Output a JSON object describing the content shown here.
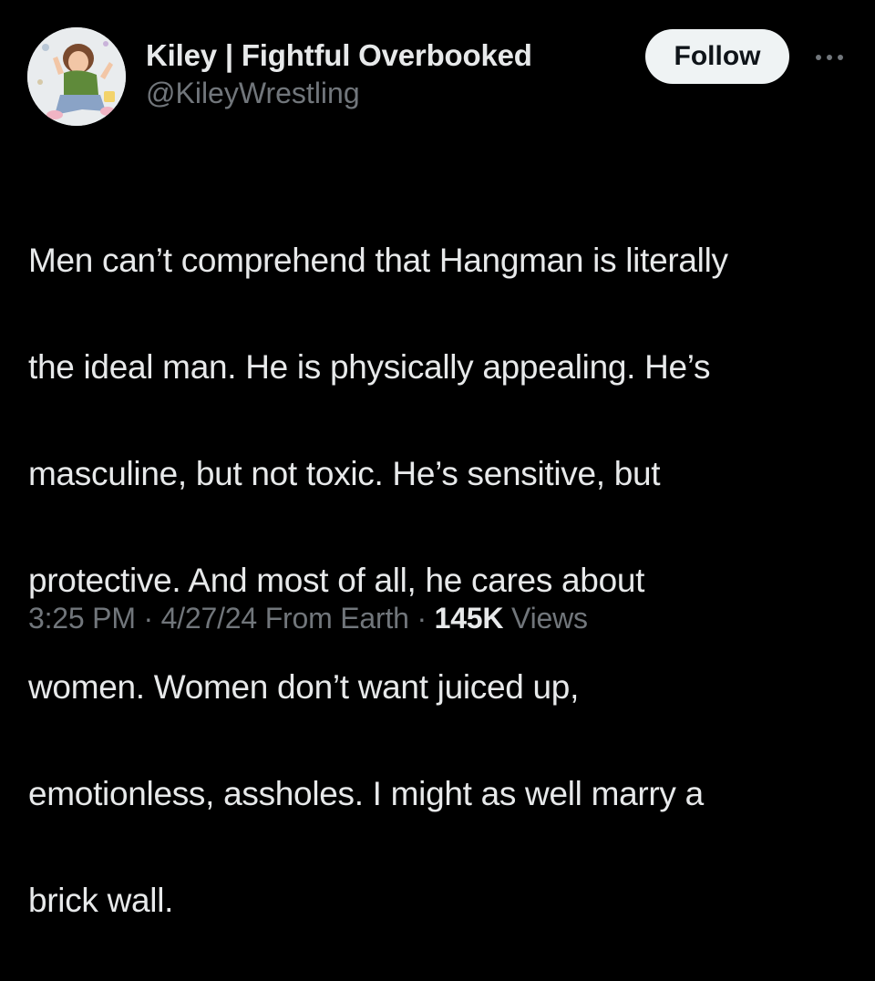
{
  "author": {
    "display_name": "Kiley | Fightful Overbooked",
    "handle": "@KileyWrestling",
    "avatar_icon": "illustrated-avatar-icon"
  },
  "actions": {
    "follow_label": "Follow",
    "more_icon": "more-dots-icon"
  },
  "tweet": {
    "text_lines": [
      "Men can’t comprehend that Hangman is literally",
      "the ideal man. He is physically appealing. He’s",
      "masculine, but not toxic. He’s sensitive, but",
      "protective. And most of all, he cares about",
      "women. Women don’t want juiced up,",
      "emotionless, assholes. I might as well marry a",
      "brick wall."
    ]
  },
  "meta": {
    "time": "3:25 PM",
    "separator": " · ",
    "date": "4/27/24",
    "source": "From Earth",
    "views_count": "145K",
    "views_label": "Views"
  },
  "colors": {
    "background": "#000000",
    "primary_text": "#e7e9ea",
    "secondary_text": "#71767b",
    "follow_button_bg": "#eff3f4",
    "follow_button_text": "#0f1419"
  }
}
